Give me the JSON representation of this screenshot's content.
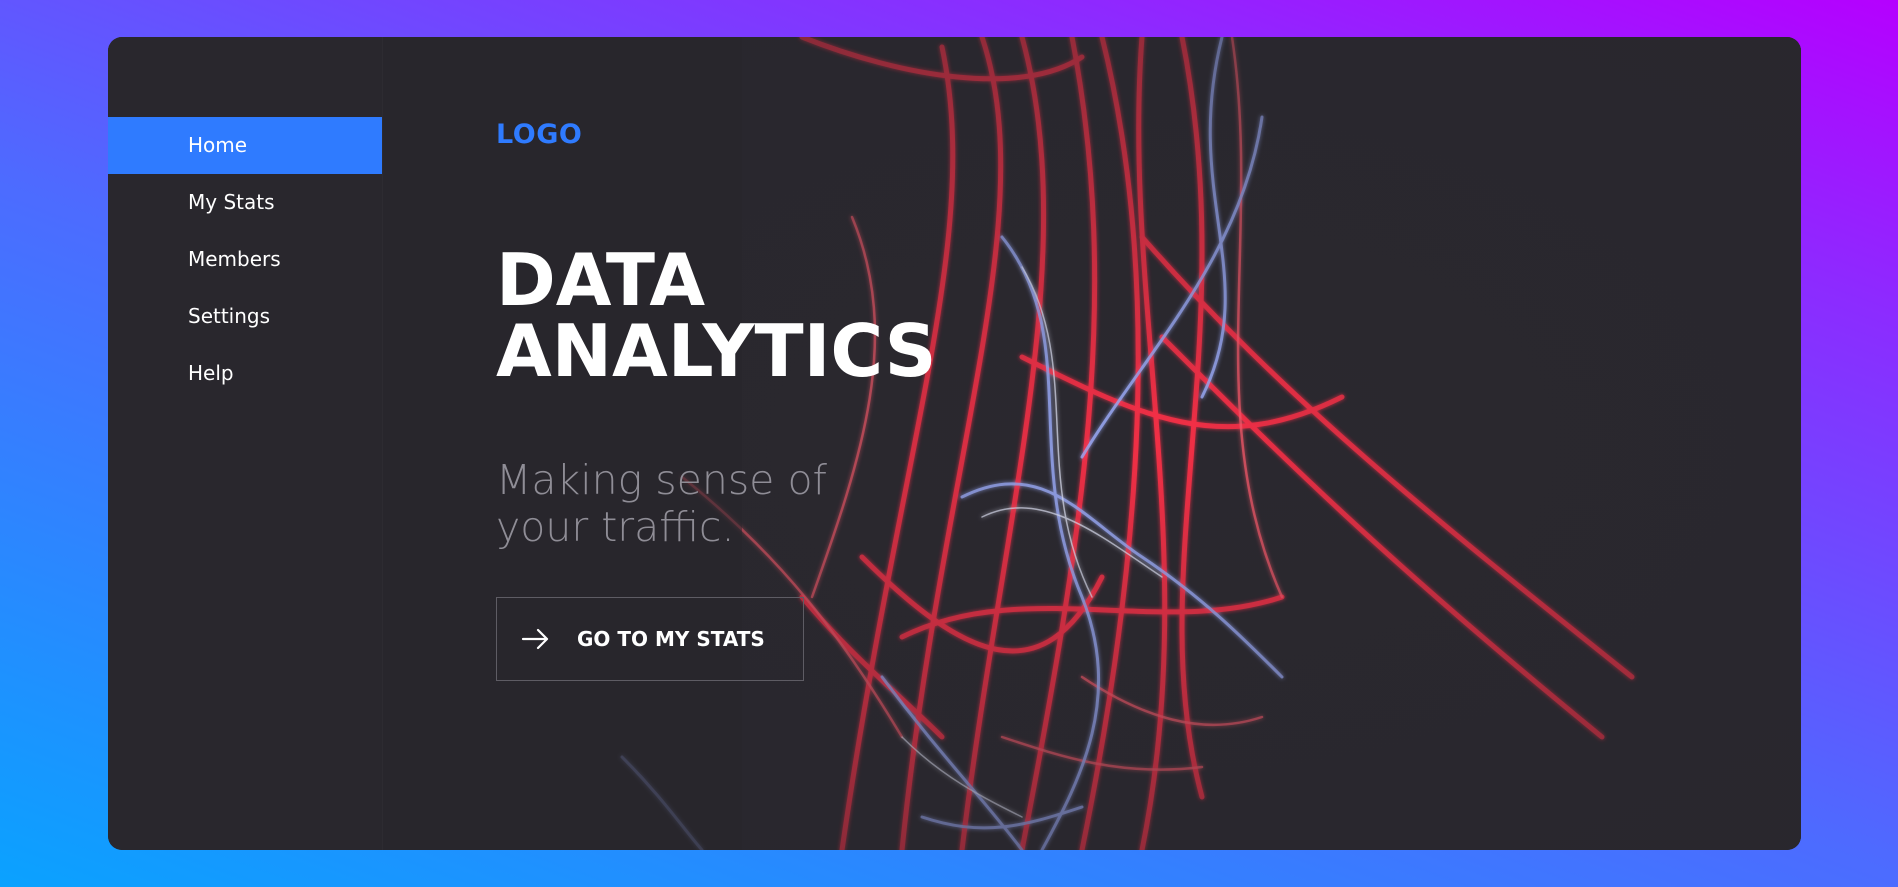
{
  "brand": {
    "logo_text": "LOGO",
    "accent_color": "#2f7bff"
  },
  "sidebar": {
    "items": [
      {
        "label": "Home",
        "active": true
      },
      {
        "label": "My Stats",
        "active": false
      },
      {
        "label": "Members",
        "active": false
      },
      {
        "label": "Settings",
        "active": false
      },
      {
        "label": "Help",
        "active": false
      }
    ]
  },
  "hero": {
    "title_line1": "DATA",
    "title_line2": "ANALYTICS",
    "subtitle_line1": "Making sense of",
    "subtitle_line2": "your traffic.",
    "cta_label": "GO TO MY STATS",
    "cta_icon": "arrow-right-icon"
  },
  "colors": {
    "card_bg": "#28262c",
    "light_trail_red": "#ff2f48",
    "light_trail_blue": "#8ea2ff",
    "gradient_start": "#0aa2ff",
    "gradient_end": "#b500ff"
  }
}
